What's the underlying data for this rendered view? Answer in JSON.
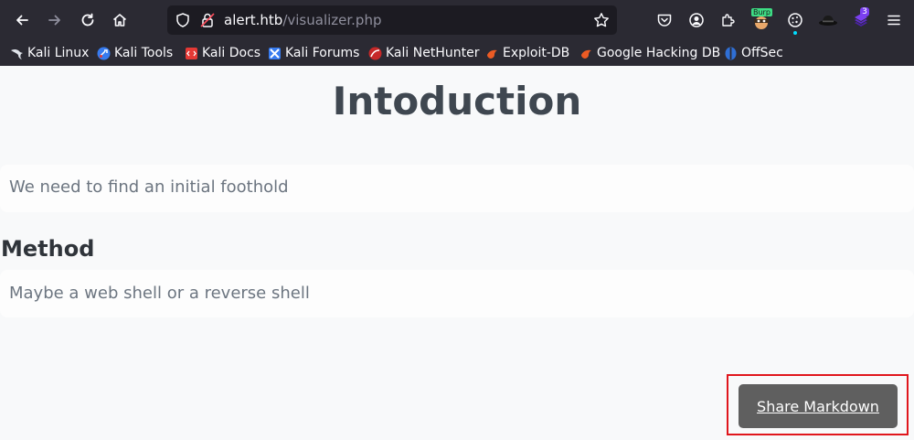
{
  "browser": {
    "url_host": "alert.htb",
    "url_path": "/visualizer.php",
    "extension_badge": "3",
    "burp_label": "Burp"
  },
  "bookmarks": [
    {
      "label": "Kali Linux",
      "icon": "kali-dragon-icon"
    },
    {
      "label": "Kali Tools",
      "icon": "kali-tools-icon"
    },
    {
      "label": "Kali Docs",
      "icon": "kali-docs-icon"
    },
    {
      "label": "Kali Forums",
      "icon": "kali-forums-icon"
    },
    {
      "label": "Kali NetHunter",
      "icon": "nethunter-icon"
    },
    {
      "label": "Exploit-DB",
      "icon": "exploit-db-icon"
    },
    {
      "label": "Google Hacking DB",
      "icon": "ghdb-icon"
    },
    {
      "label": "OffSec",
      "icon": "offsec-icon"
    }
  ],
  "page": {
    "title": "Intoduction",
    "intro_text": "We need to find an initial foothold",
    "method_heading": "Method",
    "method_text": "Maybe a web shell or a reverse shell",
    "share_button": "Share Markdown"
  },
  "colors": {
    "chrome": "#2b2a33",
    "highlight_outline": "#e0161c",
    "share_button_bg": "#5f5f5f"
  }
}
